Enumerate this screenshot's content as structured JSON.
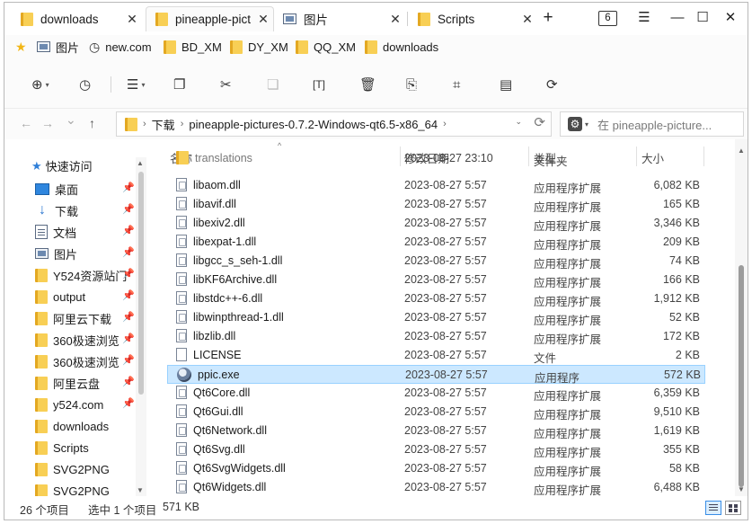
{
  "tabs": [
    {
      "title": "downloads",
      "icon": "folder-icon",
      "close": "✕"
    },
    {
      "title": "pineapple-pict",
      "icon": "folder-icon",
      "close": "✕"
    },
    {
      "title": "图片",
      "icon": "picture-icon",
      "close": "✕"
    },
    {
      "title": "Scripts",
      "icon": "folder-icon",
      "close": "✕"
    }
  ],
  "titlebar": {
    "new_tab": "+",
    "tab_count": "6",
    "menu": "☰",
    "minimize": "—",
    "maximize": "☐",
    "close": "✕"
  },
  "bookmarks": [
    {
      "label": "图片",
      "icon": "picture-icon"
    },
    {
      "label": "new.com",
      "icon": "clock-icon"
    },
    {
      "label": "BD_XM",
      "icon": "folder-icon"
    },
    {
      "label": "DY_XM",
      "icon": "folder-icon"
    },
    {
      "label": "QQ_XM",
      "icon": "folder-icon"
    },
    {
      "label": "downloads",
      "icon": "folder-icon"
    }
  ],
  "toolbar_glyphs": {
    "new": "⊕",
    "history": "◷",
    "view": "☰",
    "copy": "❐",
    "cut": "✂",
    "paste": "❏",
    "rename": "[T]",
    "delete": "🗑",
    "share": "⎘",
    "crop": "⌗",
    "properties": "▤",
    "refresh": "⟳",
    "caret": "▾"
  },
  "nav_glyphs": {
    "back": "←",
    "forward": "→",
    "recent": "⌄",
    "up": "↑"
  },
  "address": {
    "segments": [
      "下载",
      "pineapple-pictures-0.7.2-Windows-qt6.5-x86_64"
    ],
    "separator": "›",
    "dropdown": "⌄",
    "refresh": "⟳"
  },
  "search": {
    "gear": "⚙",
    "placeholder": "在 pineapple-picture..."
  },
  "sidebar": {
    "quick_access": "快速访问",
    "pin": "📌",
    "items": [
      {
        "label": "桌面",
        "icon": "desktop-icon",
        "pinned": true
      },
      {
        "label": "下载",
        "icon": "download-icon",
        "pinned": true
      },
      {
        "label": "文档",
        "icon": "document-icon",
        "pinned": true
      },
      {
        "label": "图片",
        "icon": "picture-icon",
        "pinned": true
      },
      {
        "label": "Y524资源站门",
        "icon": "folder-icon",
        "pinned": true
      },
      {
        "label": "output",
        "icon": "folder-icon",
        "pinned": true
      },
      {
        "label": "阿里云下载",
        "icon": "folder-icon",
        "pinned": true
      },
      {
        "label": "360极速浏览",
        "icon": "folder-icon",
        "pinned": true
      },
      {
        "label": "360极速浏览",
        "icon": "folder-icon",
        "pinned": true
      },
      {
        "label": "阿里云盘",
        "icon": "folder-icon",
        "pinned": true
      },
      {
        "label": "y524.com",
        "icon": "folder-icon",
        "pinned": true
      },
      {
        "label": "downloads",
        "icon": "folder-icon",
        "pinned": false
      },
      {
        "label": "Scripts",
        "icon": "folder-icon",
        "pinned": false
      },
      {
        "label": "SVG2PNG",
        "icon": "folder-icon",
        "pinned": false
      },
      {
        "label": "SVG2PNG",
        "icon": "folder-icon",
        "pinned": false
      }
    ]
  },
  "columns": {
    "name": "名称",
    "date": "修改日期",
    "type": "类型",
    "size": "大小",
    "sort": "^"
  },
  "files": [
    {
      "name": "translations",
      "date": "2023-08-27 23:10",
      "type": "文件夹",
      "size": "",
      "icon": "folder-icon",
      "clipped": true
    },
    {
      "name": "libaom.dll",
      "date": "2023-08-27 5:57",
      "type": "应用程序扩展",
      "size": "6,082 KB",
      "icon": "dll-icon"
    },
    {
      "name": "libavif.dll",
      "date": "2023-08-27 5:57",
      "type": "应用程序扩展",
      "size": "165 KB",
      "icon": "dll-icon"
    },
    {
      "name": "libexiv2.dll",
      "date": "2023-08-27 5:57",
      "type": "应用程序扩展",
      "size": "3,346 KB",
      "icon": "dll-icon"
    },
    {
      "name": "libexpat-1.dll",
      "date": "2023-08-27 5:57",
      "type": "应用程序扩展",
      "size": "209 KB",
      "icon": "dll-icon"
    },
    {
      "name": "libgcc_s_seh-1.dll",
      "date": "2023-08-27 5:57",
      "type": "应用程序扩展",
      "size": "74 KB",
      "icon": "dll-icon"
    },
    {
      "name": "libKF6Archive.dll",
      "date": "2023-08-27 5:57",
      "type": "应用程序扩展",
      "size": "166 KB",
      "icon": "dll-icon"
    },
    {
      "name": "libstdc++-6.dll",
      "date": "2023-08-27 5:57",
      "type": "应用程序扩展",
      "size": "1,912 KB",
      "icon": "dll-icon"
    },
    {
      "name": "libwinpthread-1.dll",
      "date": "2023-08-27 5:57",
      "type": "应用程序扩展",
      "size": "52 KB",
      "icon": "dll-icon"
    },
    {
      "name": "libzlib.dll",
      "date": "2023-08-27 5:57",
      "type": "应用程序扩展",
      "size": "172 KB",
      "icon": "dll-icon"
    },
    {
      "name": "LICENSE",
      "date": "2023-08-27 5:57",
      "type": "文件",
      "size": "2 KB",
      "icon": "file-icon"
    },
    {
      "name": "ppic.exe",
      "date": "2023-08-27 5:57",
      "type": "应用程序",
      "size": "572 KB",
      "icon": "exe-icon",
      "selected": true
    },
    {
      "name": "Qt6Core.dll",
      "date": "2023-08-27 5:57",
      "type": "应用程序扩展",
      "size": "6,359 KB",
      "icon": "dll-icon"
    },
    {
      "name": "Qt6Gui.dll",
      "date": "2023-08-27 5:57",
      "type": "应用程序扩展",
      "size": "9,510 KB",
      "icon": "dll-icon"
    },
    {
      "name": "Qt6Network.dll",
      "date": "2023-08-27 5:57",
      "type": "应用程序扩展",
      "size": "1,619 KB",
      "icon": "dll-icon"
    },
    {
      "name": "Qt6Svg.dll",
      "date": "2023-08-27 5:57",
      "type": "应用程序扩展",
      "size": "355 KB",
      "icon": "dll-icon"
    },
    {
      "name": "Qt6SvgWidgets.dll",
      "date": "2023-08-27 5:57",
      "type": "应用程序扩展",
      "size": "58 KB",
      "icon": "dll-icon"
    },
    {
      "name": "Qt6Widgets.dll",
      "date": "2023-08-27 5:57",
      "type": "应用程序扩展",
      "size": "6,488 KB",
      "icon": "dll-icon"
    }
  ],
  "status": {
    "count": "26 个项目",
    "selection": "选中 1 个项目",
    "size": "571 KB"
  },
  "scroll_glyphs": {
    "up": "▲",
    "down": "▼"
  },
  "colors": {
    "selection_bg": "#cce8ff",
    "selection_border": "#99d1ff",
    "folder": "#f8cf55",
    "accent": "#2f7fd8"
  }
}
